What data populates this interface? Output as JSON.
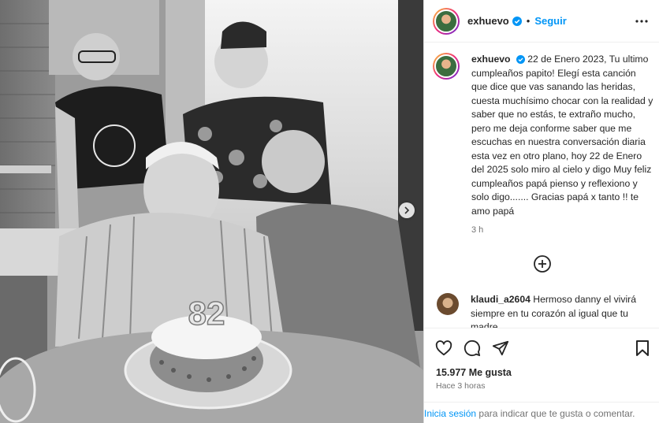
{
  "header": {
    "username": "exhuevo",
    "separator": "•",
    "follow_label": "Seguir"
  },
  "caption": {
    "username": "exhuevo",
    "text": "22 de Enero 2023, Tu ultimo cumpleaños papito! Elegí esta canción que dice que vas sanando las heridas, cuesta muchísimo chocar con la realidad y saber que no estás, te extraño mucho, pero me deja conforme saber que me escuchas en nuestra conversación diaria esta vez en otro plano, hoy 22 de Enero del 2025 solo miro al cielo y digo Muy feliz cumpleaños papá pienso y reflexiono y solo digo....... Gracias papá x tanto !! te amo papá",
    "time": "3 h"
  },
  "comment": {
    "username": "klaudi_a2604",
    "text": "Hermoso danny el vivirá siempre en tu corazón al igual que tu madre ."
  },
  "stats": {
    "likes": "15.977 Me gusta",
    "posted": "Hace 3 horas"
  },
  "login": {
    "link": "Inicia sesión",
    "text": "para indicar que te gusta o comentar."
  },
  "photo": {
    "candle_number": "82"
  },
  "colors": {
    "accent": "#0095f6",
    "text": "#262626",
    "muted": "#737373",
    "verified": "#0095f6"
  },
  "icons": [
    "verified-badge-icon",
    "more-icon",
    "add-circle-icon",
    "heart-icon",
    "comment-icon",
    "share-icon",
    "bookmark-icon",
    "chevron-right-icon"
  ]
}
